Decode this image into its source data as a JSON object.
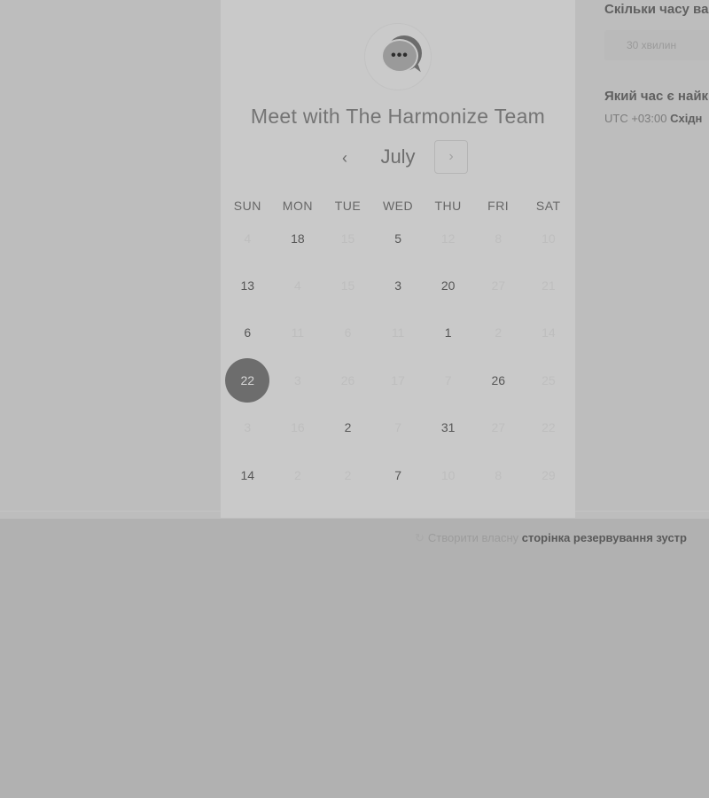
{
  "card": {
    "title": "Meet with The Harmonize Team",
    "logo_glyph": "•••",
    "logo_icon": "chat-bubbles-icon"
  },
  "calendar": {
    "month": "July",
    "prev_glyph": "‹",
    "next_glyph": "›",
    "weekdays": [
      "SUN",
      "MON",
      "TUE",
      "WED",
      "THU",
      "FRI",
      "SAT"
    ],
    "weeks": [
      [
        {
          "d": "4",
          "s": "disabled"
        },
        {
          "d": "18",
          "s": "available"
        },
        {
          "d": "15",
          "s": "disabled"
        },
        {
          "d": "5",
          "s": "available"
        },
        {
          "d": "12",
          "s": "disabled"
        },
        {
          "d": "8",
          "s": "disabled"
        },
        {
          "d": "10",
          "s": "disabled"
        }
      ],
      [
        {
          "d": "13",
          "s": "available"
        },
        {
          "d": "4",
          "s": "disabled"
        },
        {
          "d": "15",
          "s": "disabled"
        },
        {
          "d": "3",
          "s": "available"
        },
        {
          "d": "20",
          "s": "available"
        },
        {
          "d": "27",
          "s": "disabled"
        },
        {
          "d": "21",
          "s": "disabled"
        }
      ],
      [
        {
          "d": "6",
          "s": "available"
        },
        {
          "d": "11",
          "s": "disabled"
        },
        {
          "d": "6",
          "s": "disabled"
        },
        {
          "d": "11",
          "s": "disabled"
        },
        {
          "d": "1",
          "s": "available"
        },
        {
          "d": "2",
          "s": "disabled"
        },
        {
          "d": "14",
          "s": "disabled"
        }
      ],
      [
        {
          "d": "22",
          "s": "selected"
        },
        {
          "d": "3",
          "s": "disabled"
        },
        {
          "d": "26",
          "s": "disabled"
        },
        {
          "d": "17",
          "s": "disabled"
        },
        {
          "d": "7",
          "s": "disabled"
        },
        {
          "d": "26",
          "s": "available"
        },
        {
          "d": "25",
          "s": "disabled"
        }
      ],
      [
        {
          "d": "3",
          "s": "disabled"
        },
        {
          "d": "16",
          "s": "disabled"
        },
        {
          "d": "2",
          "s": "available"
        },
        {
          "d": "7",
          "s": "disabled"
        },
        {
          "d": "31",
          "s": "available"
        },
        {
          "d": "27",
          "s": "disabled"
        },
        {
          "d": "22",
          "s": "disabled"
        }
      ],
      [
        {
          "d": "14",
          "s": "available"
        },
        {
          "d": "2",
          "s": "disabled"
        },
        {
          "d": "2",
          "s": "disabled"
        },
        {
          "d": "7",
          "s": "available"
        },
        {
          "d": "10",
          "s": "disabled"
        },
        {
          "d": "8",
          "s": "disabled"
        },
        {
          "d": "29",
          "s": "disabled"
        }
      ]
    ]
  },
  "right_panel": {
    "duration_heading": "Скільки часу ва",
    "duration_option": "30 хвилин",
    "time_heading": "Який час є найк",
    "timezone_offset": "UTC +03:00",
    "timezone_name": "Східн"
  },
  "footer": {
    "icon": "link-icon",
    "icon_glyph": "↻",
    "plain": "Створити власну",
    "bold": "сторінка резервування зустр"
  },
  "colors": {
    "selected_day": "#6d6d6d",
    "card_bg": "#c9c9c9",
    "page_bg": "#b1b1b1"
  }
}
